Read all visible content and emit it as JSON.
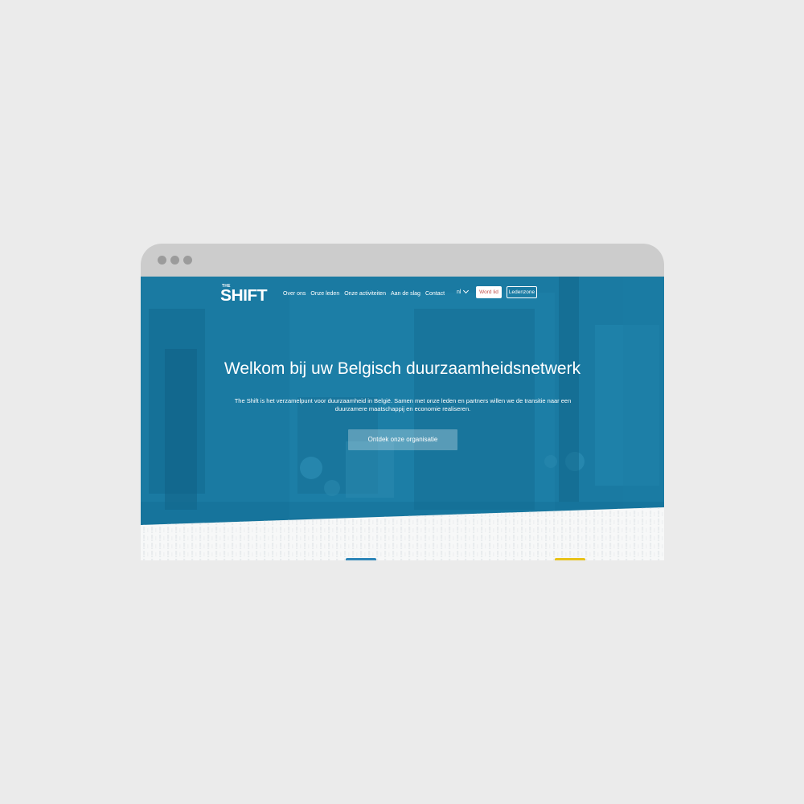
{
  "window": {
    "dots": [
      "dot-1",
      "dot-2",
      "dot-3"
    ]
  },
  "logo": {
    "small": "THE",
    "word": "SHIFT"
  },
  "nav": {
    "items": [
      {
        "label": "Over ons"
      },
      {
        "label": "Onze leden"
      },
      {
        "label": "Onze activiteiten"
      },
      {
        "label": "Aan de slag"
      },
      {
        "label": "Contact"
      }
    ],
    "language": "nl",
    "word_lid": "Word lid",
    "ledenzone": "Ledenzone"
  },
  "hero": {
    "title": "Welkom bij uw Belgisch duurzaamheidsnetwerk",
    "text": "The Shift is het verzamelpunt voor duurzaamheid in België. Samen met onze leden en partners willen we de transitie naar een duurzamere maatschappij en economie realiseren.",
    "cta": "Ontdek onze organisatie"
  },
  "colors": {
    "page_bg": "#ebebeb",
    "titlebar": "#cccccc",
    "hero_blue": "#1676a0",
    "accent_red": "#c0504a",
    "accent_yellow": "#e8c21a"
  }
}
